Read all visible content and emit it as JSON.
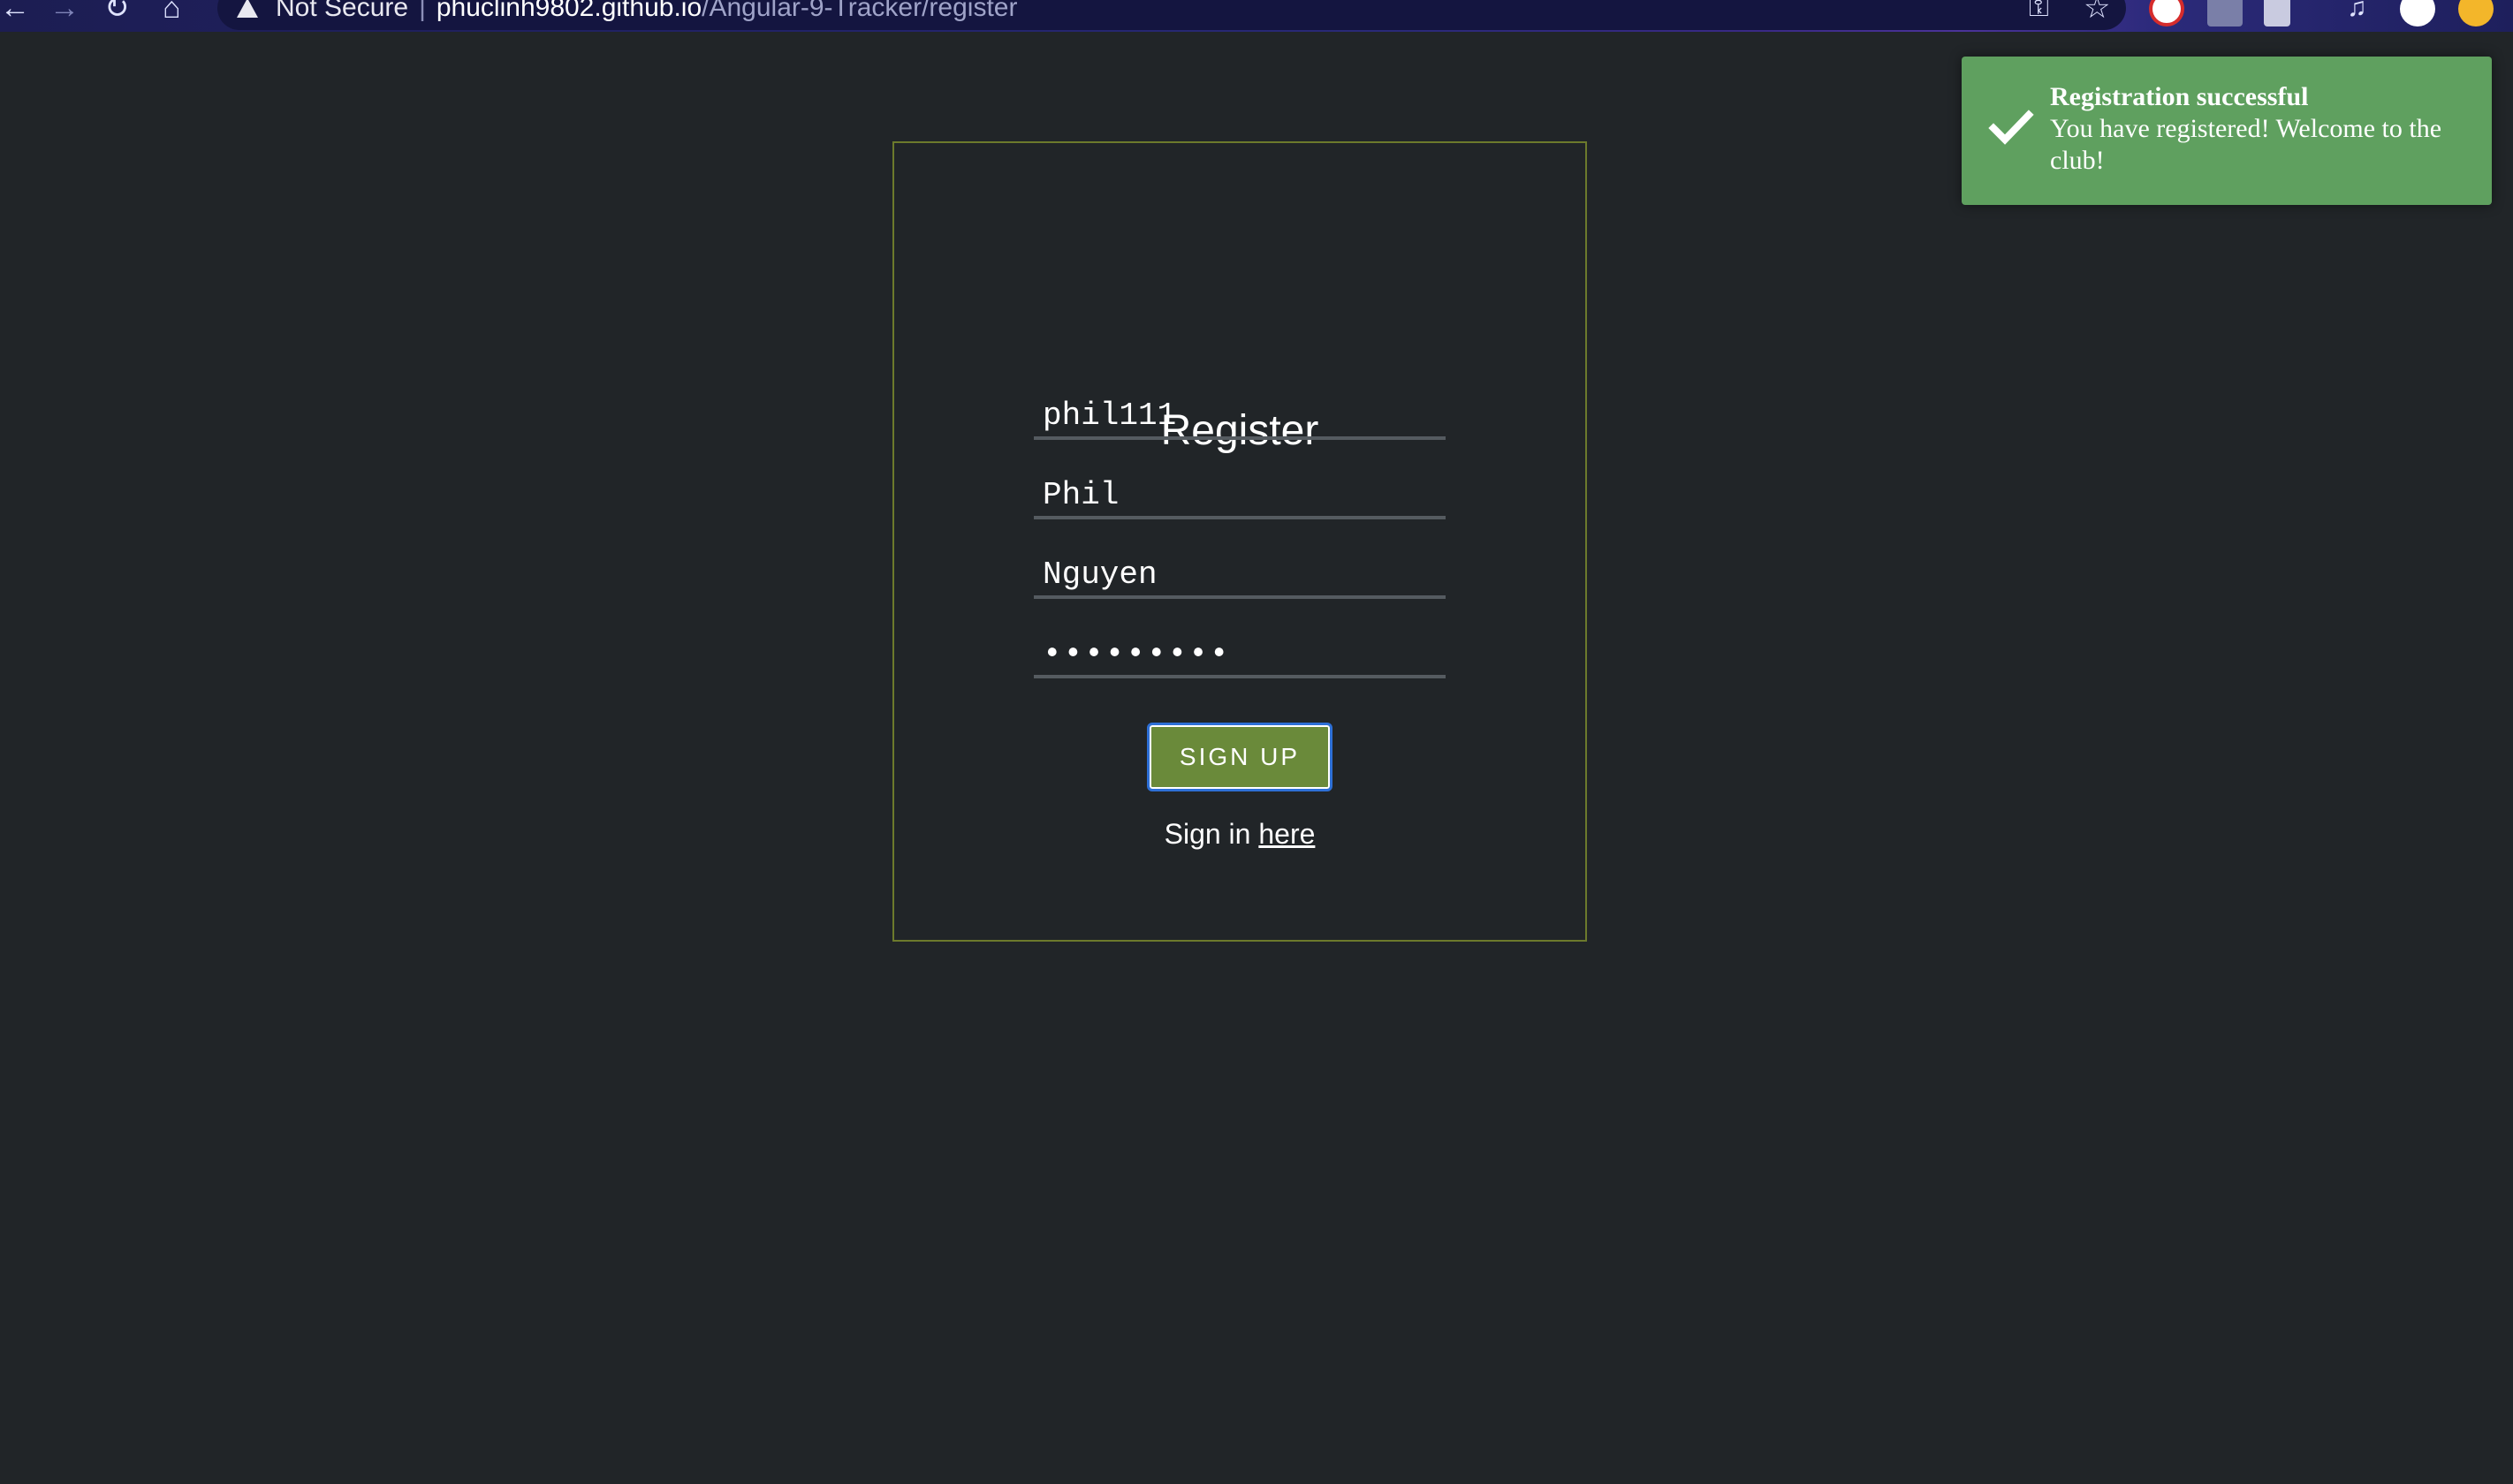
{
  "browser": {
    "security_label": "Not Secure",
    "url_host": "phuclinh9802.github.io",
    "url_path": "/Angular-9-Tracker/register"
  },
  "register": {
    "title": "Register",
    "fields": {
      "username": "phil111",
      "first_name": "Phil",
      "last_name": "Nguyen",
      "password": "•••••••••"
    },
    "signup_button": "SIGN UP",
    "signin_prefix": "Sign in ",
    "signin_link": "here"
  },
  "toast": {
    "title": "Registration successful",
    "message": "You have registered! Welcome to the club!",
    "icon": "checkmark-icon",
    "color": "#5fa05f"
  },
  "colors": {
    "background": "#212528",
    "card_border": "#6c7a2c",
    "button": "#6a8a3a"
  }
}
